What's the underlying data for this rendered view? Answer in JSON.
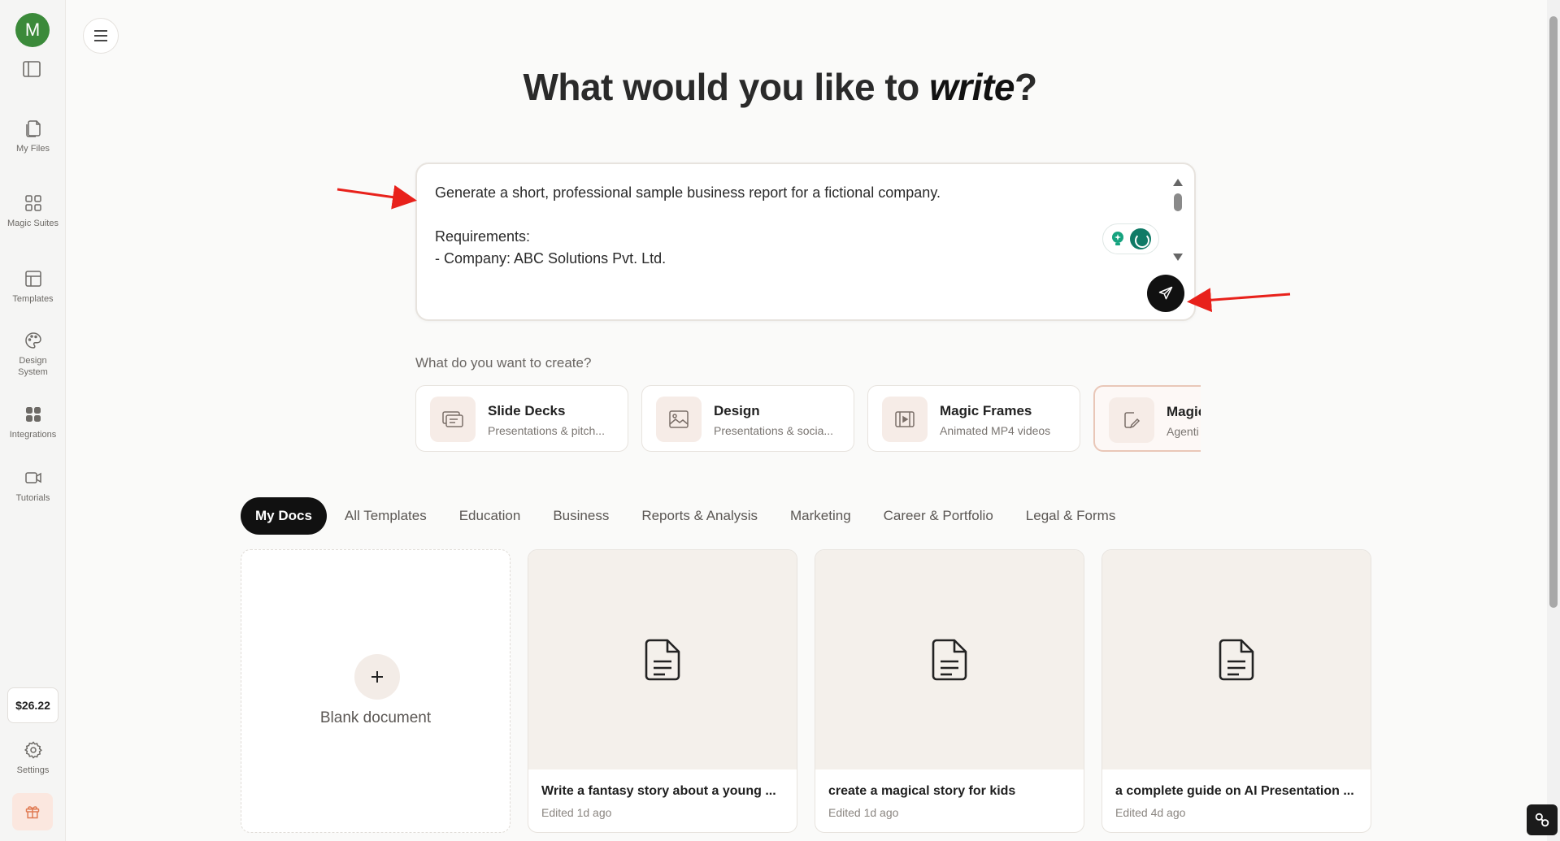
{
  "user": {
    "avatar_initial": "M"
  },
  "sidebar": {
    "items": [
      {
        "label": "My Files",
        "icon": "files-icon"
      },
      {
        "label": "Magic Suites",
        "icon": "grid-icon"
      },
      {
        "label": "Templates",
        "icon": "template-icon"
      },
      {
        "label": "Design System",
        "icon": "palette-icon"
      },
      {
        "label": "Integrations",
        "icon": "integrations-icon"
      },
      {
        "label": "Tutorials",
        "icon": "video-icon"
      }
    ],
    "credit": "$26.22",
    "settings_label": "Settings"
  },
  "headline": {
    "before": "What would you like to ",
    "emphasis": "write",
    "after": "?"
  },
  "prompt": {
    "text": "Generate a short, professional sample business report for a fictional company.\n\nRequirements:\n- Company: ABC Solutions Pvt. Ltd."
  },
  "create": {
    "label": "What do you want to create?",
    "cards": [
      {
        "title": "Slide Decks",
        "subtitle": "Presentations & pitch...",
        "icon": "slides-icon"
      },
      {
        "title": "Design",
        "subtitle": "Presentations & socia...",
        "icon": "image-icon"
      },
      {
        "title": "Magic Frames",
        "subtitle": "Animated MP4 videos",
        "icon": "video-frame-icon"
      },
      {
        "title": "Magic",
        "subtitle": "Agenti",
        "icon": "edit-doc-icon"
      }
    ]
  },
  "tabs": [
    "My Docs",
    "All Templates",
    "Education",
    "Business",
    "Reports & Analysis",
    "Marketing",
    "Career & Portfolio",
    "Legal & Forms"
  ],
  "docs": {
    "blank_label": "Blank document",
    "items": [
      {
        "title": "Write a fantasy story about a young ...",
        "edited": "Edited 1d ago"
      },
      {
        "title": "create a magical story for kids",
        "edited": "Edited 1d ago"
      },
      {
        "title": "a complete guide on AI Presentation ...",
        "edited": "Edited 4d ago"
      }
    ]
  },
  "colors": {
    "accent": "#111111",
    "avatar": "#3b8a3a",
    "annotation": "#e8211b"
  }
}
